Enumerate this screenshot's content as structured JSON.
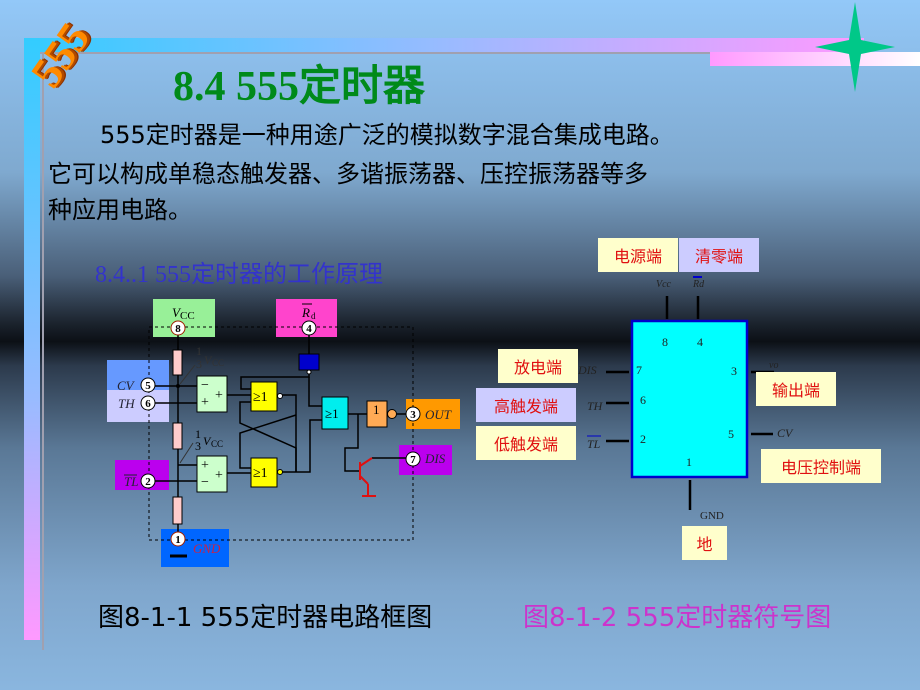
{
  "logo_text": "555",
  "title": "8.4  555定时器",
  "paragraph": {
    "line1": "555定时器是一种用途广泛的模拟数字混合集成电路。",
    "line2": "它可以构成单稳态触发器、多谐振荡器、压控振荡器等多",
    "line3": "种应用电路。"
  },
  "subheading": "8.4..1 555定时器的工作原理",
  "circuit": {
    "vcc": "V",
    "vcc_sub": "CC",
    "rd": "R",
    "rd_sub": "d",
    "pins": {
      "p1": "1",
      "p2": "2",
      "p3": "3",
      "p4": "4",
      "p5": "5",
      "p6": "6",
      "p7": "7",
      "p8": "8"
    },
    "cv": "CV",
    "th": "TH",
    "tl": "TL",
    "out": "OUT",
    "dis": "DIS",
    "gnd": "GND",
    "frac_num_top": "1",
    "frac_num_bottom": "1",
    "frac_den": "3",
    "ref_v": "V",
    "ref_sub": "CC",
    "nor": "≥1",
    "not": "1",
    "minus": "−",
    "plus": "+"
  },
  "symbol": {
    "labels": {
      "power": "电源端",
      "reset": "清零端",
      "discharge": "放电端",
      "high_trigger": "高触发端",
      "low_trigger": "低触发端",
      "output": "输出端",
      "control": "电压控制端",
      "ground": "地"
    },
    "pins": {
      "p8": "8",
      "p4": "4",
      "p7": "7",
      "p3": "3",
      "p6": "6",
      "p2": "2",
      "p5": "5",
      "p1": "1"
    },
    "vcc": "Vcc",
    "rd": "Rd",
    "dis": "DIS",
    "th": "TH",
    "tl": "TL",
    "vo": "vo",
    "cv": "CV",
    "gnd": "GND"
  },
  "captions": {
    "left": "图8-1-1 555定时器电路框图",
    "right": "图8-1-2 555定时器符号图"
  },
  "colors": {
    "title": "#008a1a",
    "subheading": "#3333cc",
    "caption_right": "#cc33cc",
    "label_text": "#e01010",
    "ic_fill": "#00ffff",
    "star": "#00c888"
  }
}
